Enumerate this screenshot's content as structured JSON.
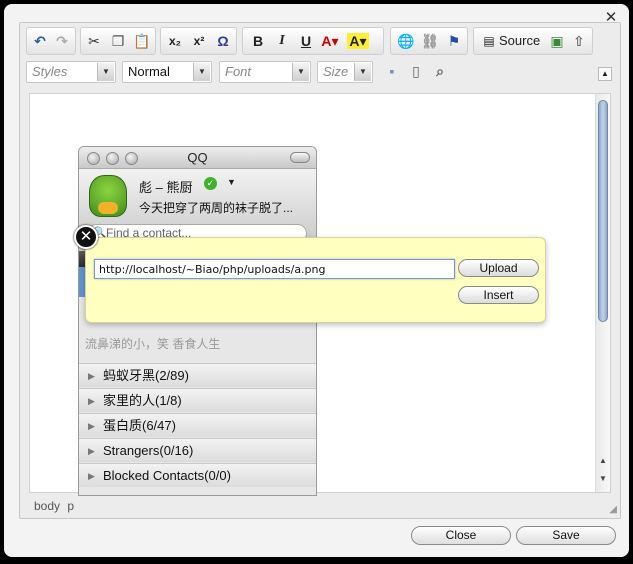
{
  "toolbar": {
    "row1": {
      "history": [
        "undo-icon",
        "redo-icon"
      ],
      "clipboard": [
        "cut-icon",
        "copy-icon",
        "paste-icon"
      ],
      "special": [
        "subscript-icon",
        "superscript-icon",
        "omega-icon"
      ],
      "format": [
        "bold-icon",
        "italic-icon",
        "underline-icon",
        "text-color-icon",
        "bg-color-icon"
      ],
      "links": [
        "globe-link-icon",
        "unlink-icon",
        "flag-anchor-icon"
      ],
      "source_label": "Source",
      "extra": [
        "image-icon",
        "upload-arrow-icon"
      ]
    },
    "row2": {
      "styles_placeholder": "Styles",
      "format_value": "Normal",
      "font_placeholder": "Font",
      "size_placeholder": "Size",
      "tools": [
        "save-icon",
        "page-icon",
        "preview-icon"
      ]
    }
  },
  "statusbar": {
    "path": "body  p"
  },
  "qq": {
    "title": "QQ",
    "nickname": "彪 – 熊厨",
    "signature": "今天把穿了两周的袜子脱了...",
    "search_placeholder": "Find a contact...",
    "faded_text": "流鼻涕的小，笑 香食人生",
    "groups": [
      "蚂蚁牙黑(2/89)",
      "家里的人(1/8)",
      "蛋白质(6/47)",
      "Strangers(0/16)",
      "Blocked Contacts(0/0)"
    ]
  },
  "popup": {
    "url_value": "http://localhost/~Biao/php/uploads/a.png",
    "upload_label": "Upload",
    "insert_label": "Insert"
  },
  "dialog": {
    "close_label": "Close",
    "save_label": "Save"
  }
}
